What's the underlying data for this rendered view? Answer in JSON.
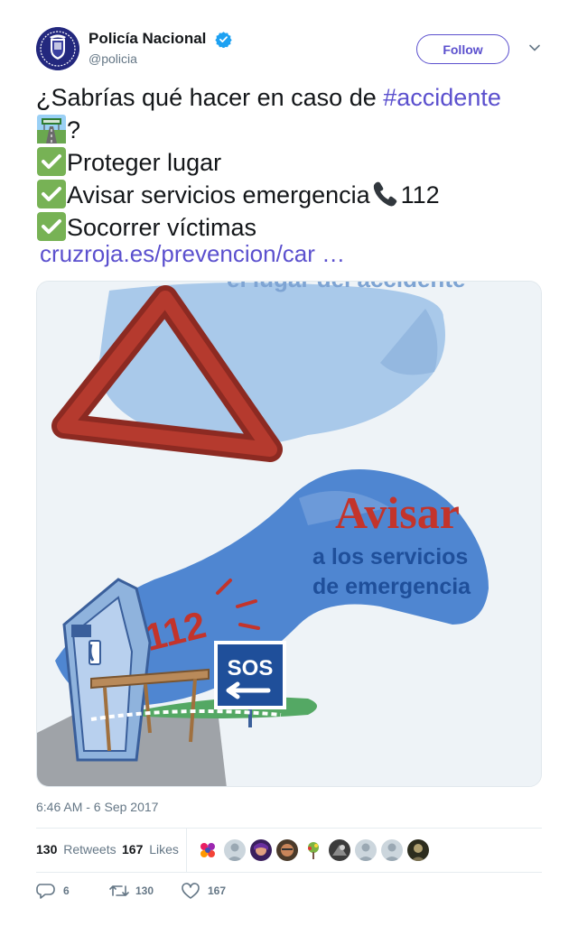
{
  "author": {
    "display_name": "Policía Nacional",
    "handle": "@policia",
    "verified": true,
    "avatar_icon": "police-emblem-icon"
  },
  "follow_label": "Follow",
  "tweet": {
    "line1_text": "¿Sabrías qué hacer en caso de ",
    "line1_hashtag": "#accidente",
    "line2_text": "?",
    "line3_text": "Proteger lugar",
    "line4_text": "Avisar servicios emergencia",
    "line4_suffix": "112",
    "line5_text": "Socorrer víctimas",
    "link": "cruzroja.es/prevencion/car …",
    "emoji": [
      "motorway-icon",
      "check-mark-button-icon",
      "telephone-receiver-icon"
    ]
  },
  "media": {
    "top_text": "el lugar del accidente",
    "heading": "Avisar",
    "subheading_line1": "a los servicios",
    "subheading_line2": "de emergencia",
    "number": "112",
    "sign": "SOS"
  },
  "timestamp": "6:46 AM - 6 Sep 2017",
  "stats": {
    "retweets_count": "130",
    "retweets_label": "Retweets",
    "likes_count": "167",
    "likes_label": "Likes"
  },
  "actions": {
    "reply_count": "6",
    "retweet_count": "130",
    "like_count": "167"
  },
  "colors": {
    "accent": "#5b50ce",
    "verified": "#1da1f2",
    "text": "#14171a",
    "muted": "#657786"
  }
}
